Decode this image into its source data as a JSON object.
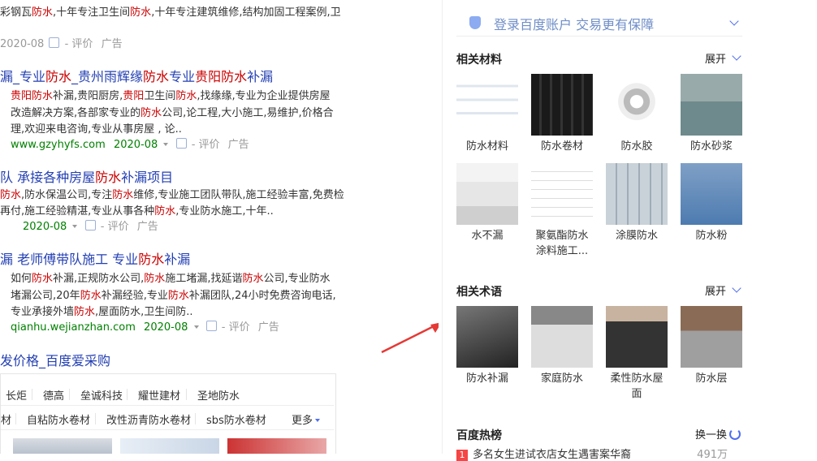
{
  "results": [
    {
      "title_parts": [],
      "desc_lines": [
        [
          {
            "t": "彩钢瓦"
          },
          {
            "t": "防水",
            "r": true
          },
          {
            "t": ",十年专注卫生间"
          },
          {
            "t": "防水",
            "r": true
          },
          {
            "t": ",十年专注建筑维修,结构加固工程案例,卫"
          }
        ]
      ],
      "date": "2020-08",
      "rate": "- 评价",
      "ad": "广告"
    },
    {
      "title_parts": [
        {
          "t": "漏_专业"
        },
        {
          "t": "防水",
          "r": true
        },
        {
          "t": "_贵州雨辉缘"
        },
        {
          "t": "防水",
          "r": true
        },
        {
          "t": "专业"
        },
        {
          "t": "贵阳",
          "r": true
        },
        {
          "t": "防水",
          "r": true
        },
        {
          "t": "补漏"
        }
      ],
      "desc_lines": [
        [
          {
            "t": "贵阳",
            "r": true
          },
          {
            "t": "防水",
            "r": true
          },
          {
            "t": "补漏,贵阳厨房,"
          },
          {
            "t": "贵阳",
            "r": true
          },
          {
            "t": "卫生间"
          },
          {
            "t": "防水",
            "r": true
          },
          {
            "t": ",找缘缘,专业为企业提供房屋"
          }
        ],
        [
          {
            "t": "改造解决方案,各部家专业的"
          },
          {
            "t": "防水",
            "r": true
          },
          {
            "t": "公司,论工程,大小施工,易维护,价格合"
          }
        ],
        [
          {
            "t": "理,欢迎来电咨询,专业从事房屋 , 论.."
          }
        ]
      ],
      "url": "www.gzyhyfs.com",
      "date": "2020-08",
      "rate": "- 评价",
      "ad": "广告"
    },
    {
      "title_parts": [
        {
          "t": "队 承接各种房屋"
        },
        {
          "t": "防水",
          "r": true
        },
        {
          "t": "补漏项目"
        }
      ],
      "desc_lines": [
        [
          {
            "t": "防水",
            "r": true
          },
          {
            "t": ",防水保温公司,专注"
          },
          {
            "t": "防水",
            "r": true
          },
          {
            "t": "维修,专业施工团队带队,施工经验丰富,免费检"
          }
        ],
        [
          {
            "t": "再付,施工经验精湛,专业从事各种"
          },
          {
            "t": "防水",
            "r": true
          },
          {
            "t": ",专业防水施工,十年.."
          }
        ]
      ],
      "url": "",
      "date": "2020-08",
      "rate": "- 评价",
      "ad": "广告"
    },
    {
      "title_parts": [
        {
          "t": "漏 老师傅带队施工 专业"
        },
        {
          "t": "防水",
          "r": true
        },
        {
          "t": "补漏"
        }
      ],
      "desc_lines": [
        [
          {
            "t": "如何"
          },
          {
            "t": "防水",
            "r": true
          },
          {
            "t": "补漏,正规防水公司,"
          },
          {
            "t": "防水",
            "r": true
          },
          {
            "t": "施工堵漏,找延谐"
          },
          {
            "t": "防水",
            "r": true
          },
          {
            "t": "公司,专业防水"
          }
        ],
        [
          {
            "t": "堵漏公司,20年"
          },
          {
            "t": "防水",
            "r": true
          },
          {
            "t": "补漏经验,专业"
          },
          {
            "t": "防水",
            "r": true
          },
          {
            "t": "补漏团队,24小时免费咨询电话,"
          }
        ],
        [
          {
            "t": "专业承接外墙"
          },
          {
            "t": "防水",
            "r": true
          },
          {
            "t": ",屋面防水,卫生间防.."
          }
        ]
      ],
      "url": "qianhu.wejianzhan.com",
      "date": "2020-08",
      "rate": "- 评价",
      "ad": "广告"
    }
  ],
  "aicai": {
    "title": "发价格_百度爱采购",
    "chips_row1": [
      "长炬",
      "德高",
      "垒诚科技",
      "耀世建材",
      "圣地防水"
    ],
    "chips_row2": [
      "材",
      "自粘防水卷材",
      "改性沥青防水卷材",
      "sbs防水卷材"
    ],
    "more": "更多"
  },
  "right": {
    "login": "登录百度账户  交易更有保障",
    "materials_title": "相关材料",
    "expand_label": "展开",
    "materials": [
      {
        "label": "防水材料",
        "img": "doc"
      },
      {
        "label": "防水卷材",
        "img": "rolls"
      },
      {
        "label": "防水胶",
        "img": "tape"
      },
      {
        "label": "防水砂浆",
        "img": "room"
      },
      {
        "label": "水不漏",
        "img": "bags"
      },
      {
        "label": "聚氨酯防水涂料施工...",
        "img": "drawing"
      },
      {
        "label": "涂膜防水",
        "img": "buckets"
      },
      {
        "label": "防水粉",
        "img": "sacks"
      }
    ],
    "terms_title": "相关术语",
    "terms": [
      {
        "label": "防水补漏",
        "img": "roof"
      },
      {
        "label": "家庭防水",
        "img": "worker"
      },
      {
        "label": "柔性防水屋面",
        "img": "membrane"
      },
      {
        "label": "防水层",
        "img": "layers"
      }
    ],
    "hot_title": "百度热榜",
    "refresh_label": "换一换",
    "hot_rows": [
      {
        "rank": "1",
        "text": "多名女生进试衣店女生遇害案华裔",
        "count": "491万"
      }
    ]
  },
  "colors": {
    "title_blue": "#2440b3",
    "keyword_red": "#cc0000",
    "url_green": "#008000",
    "accent": "#4e6ef2"
  }
}
